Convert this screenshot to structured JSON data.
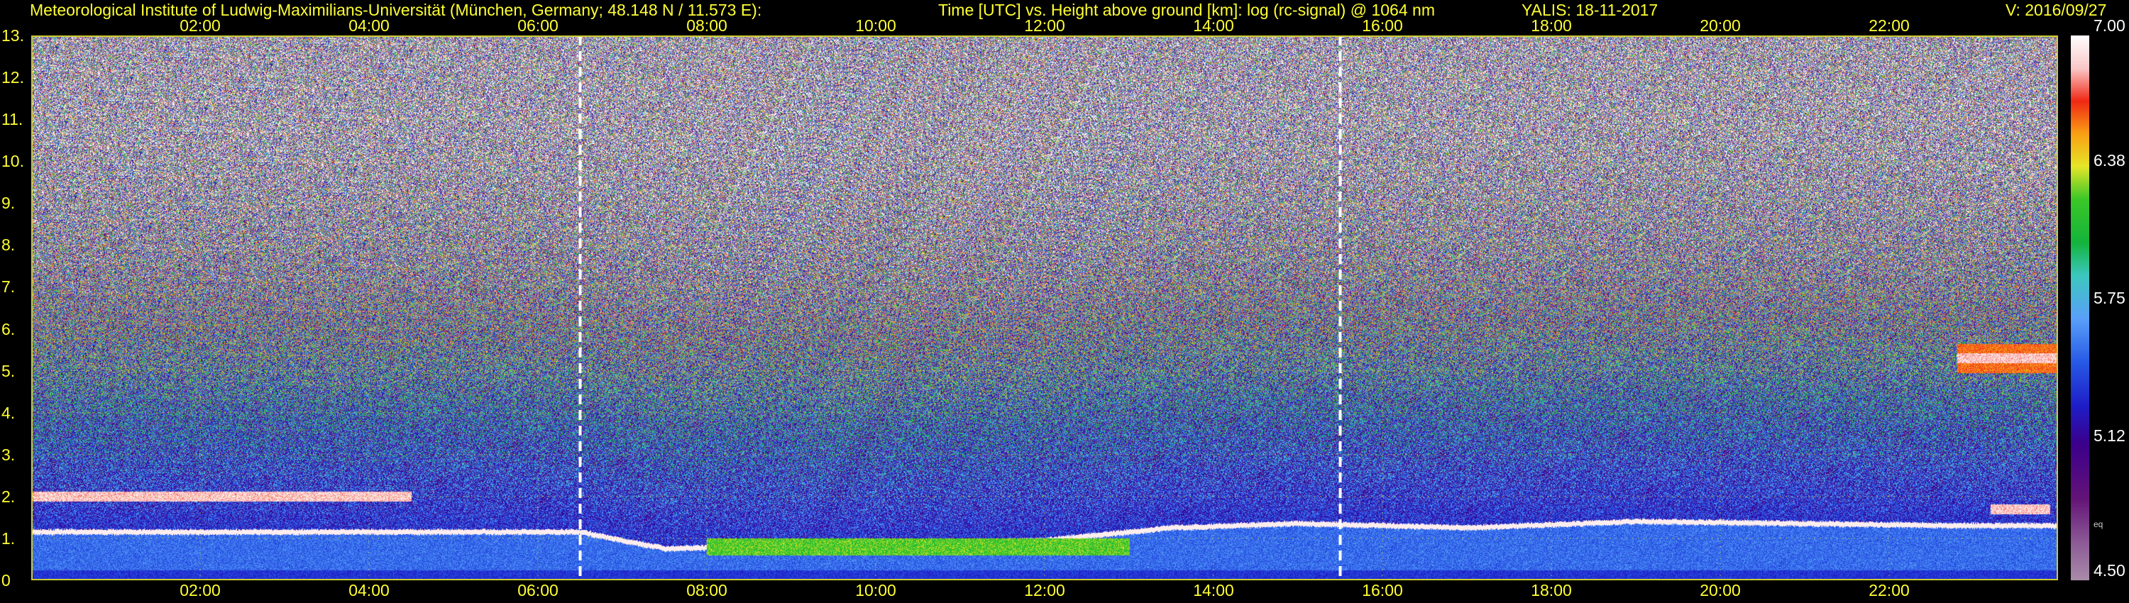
{
  "header": {
    "institute": "Meteorological Institute of Ludwig-Maximilians-Universität (München, Germany; 48.148 N / 11.573 E):",
    "description": "Time [UTC] vs. Height above ground [km]: log (rc-signal) @ 1064 nm",
    "instrument_date": "YALIS: 18-11-2017",
    "version": "V: 2016/09/27"
  },
  "colors": {
    "text": "#ffff33",
    "grid": "#cccc33",
    "vline": "#ffffff",
    "background": "#000000"
  },
  "chart_data": {
    "type": "heatmap",
    "xlabel": "",
    "ylabel": "",
    "x_ticks": [
      "02:00",
      "04:00",
      "06:00",
      "08:00",
      "10:00",
      "12:00",
      "14:00",
      "16:00",
      "18:00",
      "20:00",
      "22:00"
    ],
    "x_tick_hours": [
      2,
      4,
      6,
      8,
      10,
      12,
      14,
      16,
      18,
      20,
      22
    ],
    "x_range_hours": [
      0,
      24
    ],
    "y_ticks": [
      "0",
      "1.",
      "2.",
      "3.",
      "4.",
      "5.",
      "6.",
      "7.",
      "8.",
      "9.",
      "10.",
      "11.",
      "12.",
      "13."
    ],
    "ylim_km": [
      0,
      13
    ],
    "grid": true,
    "dashed_vertical_lines_hours": [
      6.5,
      15.5
    ],
    "colorbar": {
      "ticks": [
        "7.00",
        "6.38",
        "5.75",
        "5.12",
        "4.50"
      ],
      "range": [
        4.5,
        7.0
      ],
      "note": "eq"
    },
    "features": [
      {
        "kind": "boundary_layer_top",
        "points_hours_km": [
          [
            0,
            1.1
          ],
          [
            6.5,
            1.1
          ],
          [
            7.5,
            0.7
          ],
          [
            10,
            0.8
          ],
          [
            12,
            0.9
          ],
          [
            13.5,
            1.2
          ],
          [
            15,
            1.3
          ],
          [
            17,
            1.2
          ],
          [
            19,
            1.35
          ],
          [
            21,
            1.3
          ],
          [
            22.8,
            1.25
          ]
        ]
      },
      {
        "kind": "cloud_layer",
        "hours": [
          0,
          4.5
        ],
        "height_km": 2.0
      },
      {
        "kind": "elevated_aerosol",
        "hours": [
          8,
          13
        ],
        "height_km": 0.8
      },
      {
        "kind": "cloud_layer",
        "hours": [
          22.8,
          24
        ],
        "height_km": 5.3
      },
      {
        "kind": "cloud_layer",
        "hours": [
          23.2,
          23.9
        ],
        "height_km": 1.7
      }
    ]
  }
}
